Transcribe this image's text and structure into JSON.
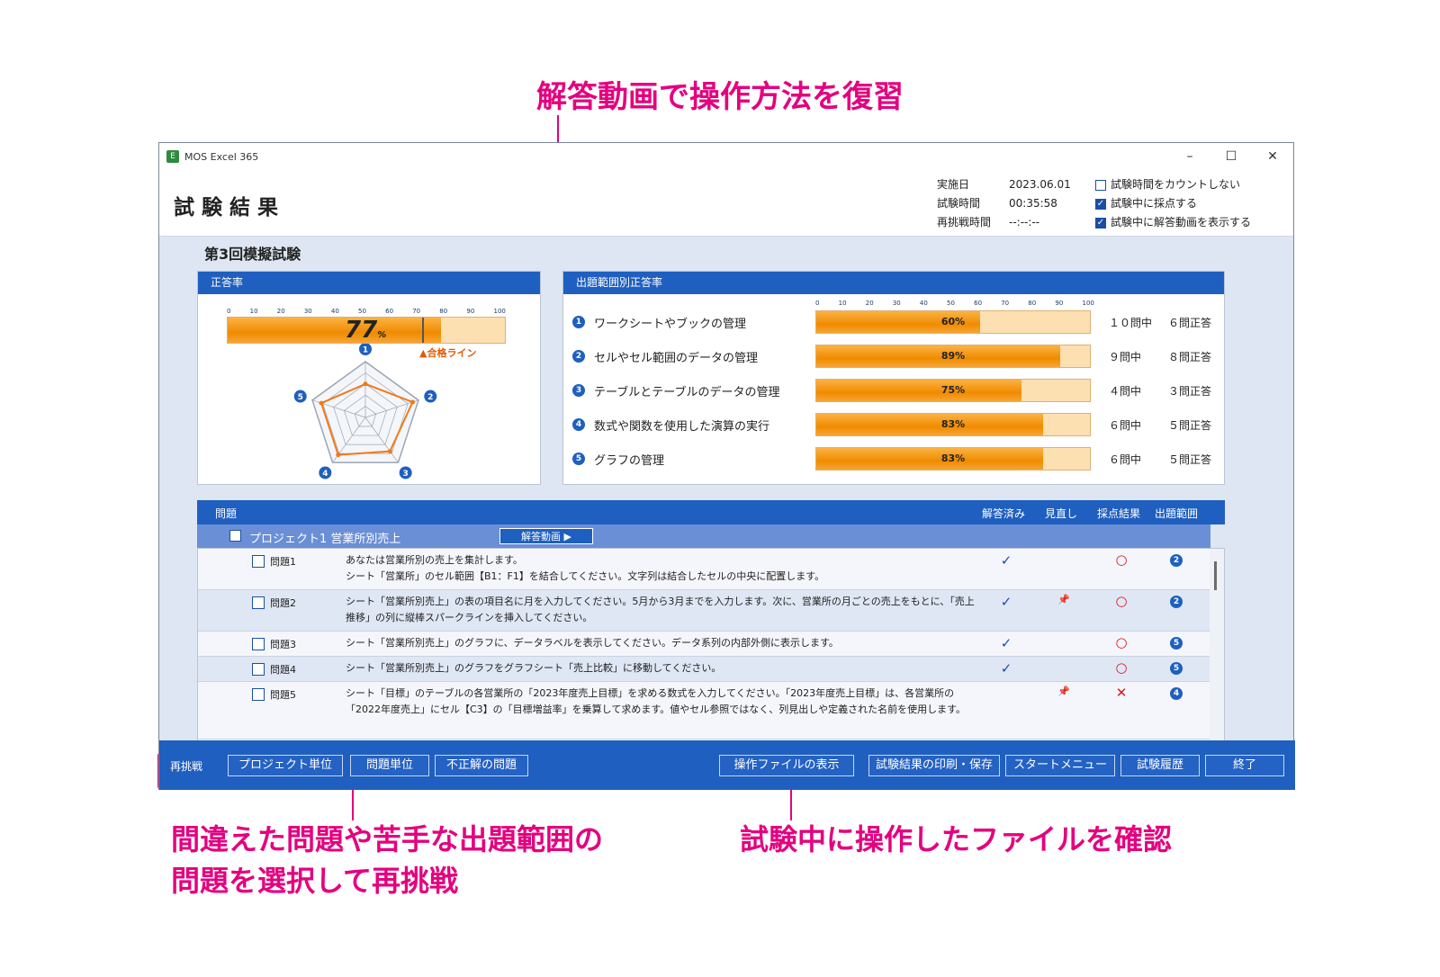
{
  "annotations": {
    "top": "解答動画で操作方法を復習",
    "bottom_left_1": "間違えた問題や苦手な出題範囲の",
    "bottom_left_2": "問題を選択して再挑戦",
    "bottom_right": "試験中に操作したファイルを確認"
  },
  "window": {
    "app_title": "MOS Excel 365",
    "minimize": "–",
    "maximize": "☐",
    "close": "✕"
  },
  "header": {
    "title": "試験結果",
    "meta": [
      {
        "label": "実施日",
        "value": "2023.06.01"
      },
      {
        "label": "試験時間",
        "value": "00:35:58"
      },
      {
        "label": "再挑戦時間",
        "value": "--:--:--"
      }
    ],
    "options": [
      {
        "label": "試験時間をカウントしない",
        "checked": false
      },
      {
        "label": "試験中に採点する",
        "checked": true
      },
      {
        "label": "試験中に解答動画を表示する",
        "checked": true
      }
    ]
  },
  "exam_name": "第3回模擬試験",
  "score_panel": {
    "title": "正答率",
    "scale": [
      "0",
      "10",
      "20",
      "30",
      "40",
      "50",
      "60",
      "70",
      "80",
      "90",
      "100"
    ],
    "score_number": "77",
    "score_unit": "%",
    "score_value": 77,
    "pass_line_value": 70,
    "pass_line_label": "▲合格ライン",
    "radar_labels": [
      "1",
      "2",
      "3",
      "4",
      "5"
    ]
  },
  "category_panel": {
    "title": "出題範囲別正答率",
    "scale": [
      "0",
      "10",
      "20",
      "30",
      "40",
      "50",
      "60",
      "70",
      "80",
      "90",
      "100"
    ],
    "items": [
      {
        "num": "1",
        "label": "ワークシートやブックの管理",
        "percent": 60,
        "percent_label": "60%",
        "total": "１０問中",
        "correct": "６問正答"
      },
      {
        "num": "2",
        "label": "セルやセル範囲のデータの管理",
        "percent": 89,
        "percent_label": "89%",
        "total": "９問中",
        "correct": "８問正答"
      },
      {
        "num": "3",
        "label": "テーブルとテーブルのデータの管理",
        "percent": 75,
        "percent_label": "75%",
        "total": "４問中",
        "correct": "３問正答"
      },
      {
        "num": "4",
        "label": "数式や関数を使用した演算の実行",
        "percent": 83,
        "percent_label": "83%",
        "total": "６問中",
        "correct": "５問正答"
      },
      {
        "num": "5",
        "label": "グラフの管理",
        "percent": 83,
        "percent_label": "83%",
        "total": "６問中",
        "correct": "５問正答"
      }
    ]
  },
  "question_list": {
    "header": "問題",
    "columns": [
      "解答済み",
      "見直し",
      "採点結果",
      "出題範囲"
    ],
    "project": "プロジェクト1 営業所別売上",
    "video_button": "解答動画 ▶",
    "questions": [
      {
        "label": "問題1",
        "text": "あなたは営業所別の売上を集計します。\nシート「営業所」のセル範囲【B1：F1】を結合してください。文字列は結合したセルの中央に配置します。",
        "answered": "✓",
        "review": "",
        "result": "○",
        "category": "2"
      },
      {
        "label": "問題2",
        "text": "シート「営業所別売上」の表の項目名に月を入力してください。5月から3月までを入力します。次に、営業所の月ごとの売上をもとに、「売上推移」の列に縦棒スパークラインを挿入してください。",
        "answered": "✓",
        "review": "📌",
        "result": "○",
        "category": "2"
      },
      {
        "label": "問題3",
        "text": "シート「営業所別売上」のグラフに、データラベルを表示してください。データ系列の内部外側に表示します。",
        "answered": "✓",
        "review": "",
        "result": "○",
        "category": "5"
      },
      {
        "label": "問題4",
        "text": "シート「営業所別売上」のグラフをグラフシート「売上比較」に移動してください。",
        "answered": "✓",
        "review": "",
        "result": "○",
        "category": "5"
      },
      {
        "label": "問題5",
        "text": "シート「目標」のテーブルの各営業所の「2023年度売上目標」を求める数式を入力してください。「2023年度売上目標」は、各営業所の「2022年度売上」にセル【C3】の「目標増益率」を乗算して求めます。値やセル参照ではなく、列見出しや定義された名前を使用します。",
        "answered": "",
        "review": "📌",
        "result": "✕",
        "category": "4"
      }
    ]
  },
  "footer": {
    "retry_label": "再挑戦",
    "retry_buttons": [
      "プロジェクト単位",
      "問題単位",
      "不正解の問題"
    ],
    "show_files": "操作ファイルの表示",
    "print_save": "試験結果の印刷・保存",
    "start_menu": "スタートメニュー",
    "history": "試験履歴",
    "exit": "終了"
  },
  "colors": {
    "accent": "#e4007f",
    "header_blue": "#1f5fbf",
    "bar_orange": "#f08b00",
    "radar_orange": "#f07a1a"
  }
}
